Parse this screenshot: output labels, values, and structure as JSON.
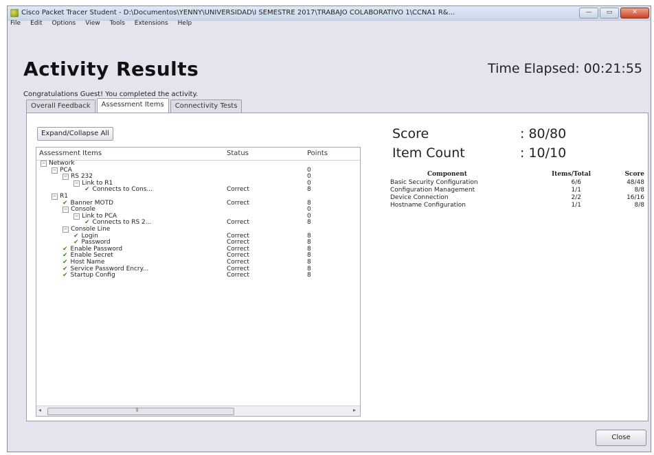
{
  "window": {
    "title": "Cisco Packet Tracer Student - D:\\Documentos\\YENNY\\UNIVERSIDAD\\I SEMESTRE 2017\\TRABAJO COLABORATIVO 1\\CCNA1 R&...",
    "minimize": "—",
    "maximize": "▭",
    "close": "✕"
  },
  "menu": [
    "File",
    "Edit",
    "Options",
    "View",
    "Tools",
    "Extensions",
    "Help"
  ],
  "heading": "Activity Results",
  "time_elapsed": "Time Elapsed: 00:21:55",
  "congrats": "Congratulations Guest! You completed the activity.",
  "tabs": [
    "Overall Feedback",
    "Assessment Items",
    "Connectivity Tests"
  ],
  "expand_button": "Expand/Collapse All",
  "tree": {
    "headers": {
      "item": "Assessment Items",
      "status": "Status",
      "points": "Points"
    },
    "rows": [
      {
        "label": "Network",
        "level": 0,
        "toggle": "⊟",
        "check": false,
        "status": "",
        "points": ""
      },
      {
        "label": "PCA",
        "level": 1,
        "toggle": "⊟",
        "check": false,
        "status": "",
        "points": "0"
      },
      {
        "label": "RS 232",
        "level": 2,
        "toggle": "⊟",
        "check": false,
        "status": "",
        "points": "0"
      },
      {
        "label": "Link to R1",
        "level": 3,
        "toggle": "⊟",
        "check": false,
        "status": "",
        "points": "0"
      },
      {
        "label": "Connects to Cons...",
        "level": 4,
        "toggle": "",
        "check": true,
        "status": "Correct",
        "points": "8"
      },
      {
        "label": "R1",
        "level": 1,
        "toggle": "⊟",
        "check": false,
        "status": "",
        "points": ""
      },
      {
        "label": "Banner MOTD",
        "level": 2,
        "toggle": "",
        "check": true,
        "status": "Correct",
        "points": "8"
      },
      {
        "label": "Console",
        "level": 2,
        "toggle": "⊟",
        "check": false,
        "status": "",
        "points": "0"
      },
      {
        "label": "Link to PCA",
        "level": 3,
        "toggle": "⊟",
        "check": false,
        "status": "",
        "points": "0"
      },
      {
        "label": "Connects to RS 2...",
        "level": 4,
        "toggle": "",
        "check": true,
        "status": "Correct",
        "points": "8"
      },
      {
        "label": "Console Line",
        "level": 2,
        "toggle": "⊟",
        "check": false,
        "status": "",
        "points": ""
      },
      {
        "label": "Login",
        "level": 3,
        "toggle": "",
        "check": true,
        "status": "Correct",
        "points": "8"
      },
      {
        "label": "Password",
        "level": 3,
        "toggle": "",
        "check": true,
        "status": "Correct",
        "points": "8"
      },
      {
        "label": "Enable Password",
        "level": 2,
        "toggle": "",
        "check": true,
        "status": "Correct",
        "points": "8"
      },
      {
        "label": "Enable Secret",
        "level": 2,
        "toggle": "",
        "check": true,
        "status": "Correct",
        "points": "8"
      },
      {
        "label": "Host Name",
        "level": 2,
        "toggle": "",
        "check": true,
        "status": "Correct",
        "points": "8"
      },
      {
        "label": "Service Password Encry...",
        "level": 2,
        "toggle": "",
        "check": true,
        "status": "Correct",
        "points": "8"
      },
      {
        "label": "Startup Config",
        "level": 2,
        "toggle": "",
        "check": true,
        "status": "Correct",
        "points": "8"
      }
    ],
    "scroll_left": "◂",
    "scroll_right": "▸",
    "scroll_grip": "⦀"
  },
  "score": {
    "label": "Score",
    "value": ": 80/80"
  },
  "item_count": {
    "label": "Item Count",
    "value": ": 10/10"
  },
  "components": {
    "headers": {
      "component": "Component",
      "items": "Items/Total",
      "score": "Score"
    },
    "rows": [
      {
        "component": "Basic Security Configuration",
        "items": "6/6",
        "score": "48/48"
      },
      {
        "component": "Configuration Management",
        "items": "1/1",
        "score": "8/8"
      },
      {
        "component": "Device Connection",
        "items": "2/2",
        "score": "16/16"
      },
      {
        "component": "Hostname Configuration",
        "items": "1/1",
        "score": "8/8"
      }
    ]
  },
  "close_button": "Close",
  "colors": {
    "accent_check": "#3a8a1a",
    "window_bg": "#e4e3ee"
  }
}
